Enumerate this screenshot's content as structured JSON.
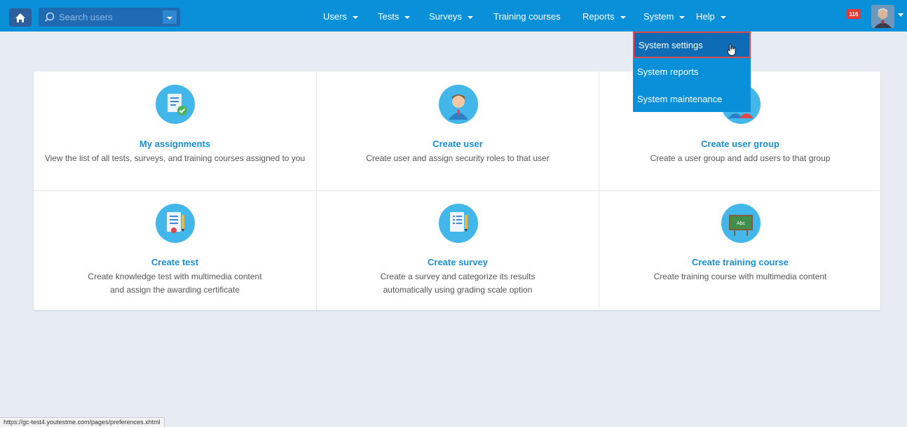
{
  "search": {
    "placeholder": "Search users"
  },
  "nav": [
    {
      "label": "Users",
      "has_dropdown": true
    },
    {
      "label": "Tests",
      "has_dropdown": true
    },
    {
      "label": "Surveys",
      "has_dropdown": true
    },
    {
      "label": "Training courses",
      "has_dropdown": false
    },
    {
      "label": "Reports",
      "has_dropdown": true
    },
    {
      "label": "System",
      "has_dropdown": true
    },
    {
      "label": "Help",
      "has_dropdown": true
    }
  ],
  "notifications": {
    "count": "116"
  },
  "system_menu": {
    "items": [
      {
        "label": "System settings",
        "highlighted": true
      },
      {
        "label": "System reports"
      },
      {
        "label": "System maintenance"
      }
    ]
  },
  "cards": [
    {
      "title": "My assignments",
      "description": "View the list of all tests, surveys, and training courses assigned to you",
      "icon": "assignment-checklist-icon"
    },
    {
      "title": "Create user",
      "description": "Create user and assign security roles to that user",
      "icon": "user-icon"
    },
    {
      "title": "Create user group",
      "description": "Create a user group and add users to that group",
      "icon": "user-group-icon"
    },
    {
      "title": "Create test",
      "description_lines": [
        "Create knowledge test with multimedia content",
        "and assign the awarding certificate"
      ],
      "icon": "test-document-icon"
    },
    {
      "title": "Create survey",
      "description_lines": [
        "Create a survey and categorize its results",
        "automatically using grading scale option"
      ],
      "icon": "survey-document-icon"
    },
    {
      "title": "Create training course",
      "description": "Create training course with multimedia content",
      "icon": "chalkboard-icon",
      "icon_text": "Abc"
    }
  ],
  "status_url": "https://gc-test4.youtestme.com/pages/preferences.xhtml",
  "colors": {
    "topbar": "#0a90d8",
    "accent": "#1a8fd6",
    "highlight_border": "#e2484c",
    "background": "#e7ebf3"
  }
}
